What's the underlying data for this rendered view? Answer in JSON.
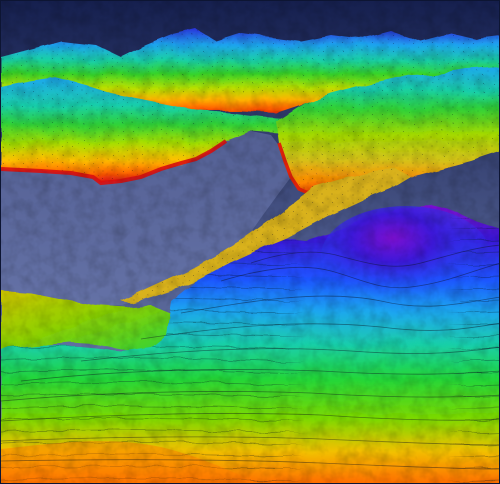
{
  "render": {
    "background_top": "#16204f",
    "background_bottom": "#7f8fc2",
    "colormap": [
      "#d90f0f",
      "#ff7a00",
      "#ffd400",
      "#9be000",
      "#22d63a",
      "#19cfa8",
      "#1da6f0",
      "#1f53ff",
      "#3a18d9",
      "#7b10d0"
    ],
    "contour_color": "#0b1020",
    "wireframe_color": "#101623"
  }
}
